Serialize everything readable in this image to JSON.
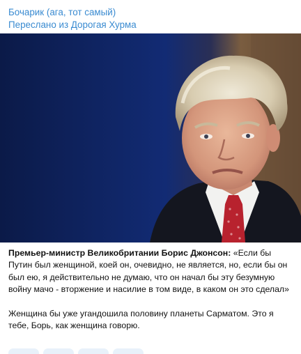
{
  "message": {
    "channel_name": "Бочарик (ага, тот самый)",
    "forwarded_from": "Переслано из Дорогая Хурма",
    "caption": {
      "speaker": "Премьер-министр Великобритании Борис Джонсон:",
      "quote": " «Если бы Путин был женщиной, коей он, очевидно, не является, но, если бы он был ею, я действительно не думаю, что он начал бы эту безумную войну мачо - вторжение и насилие в том виде, в каком он это сделал»",
      "comment": "Женщина бы уже угандошила половину планеты Сарматом. Это я тебе, Борь, как женщина говорю."
    },
    "photo": {
      "subject": "grey-haired man in dark suit, white shirt and red patterned tie",
      "background_colors": [
        "#0c1d4e",
        "#112a72",
        "#8a6a48"
      ]
    }
  },
  "colors": {
    "accent": "#3a8bd1",
    "bubble": "#ffffff",
    "text": "#111111"
  }
}
